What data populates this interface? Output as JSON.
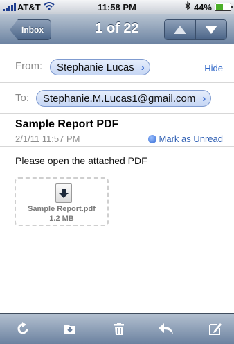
{
  "status_bar": {
    "carrier": "AT&T",
    "time": "11:58 PM",
    "battery_percent": "44%",
    "battery_level": 0.44,
    "icons": [
      "signal-icon",
      "wifi-icon",
      "bluetooth-icon",
      "battery-icon"
    ]
  },
  "nav": {
    "back_label": "Inbox",
    "title": "1 of 22",
    "prev_icon": "up-arrow-icon",
    "next_icon": "down-arrow-icon"
  },
  "header": {
    "from_label": "From:",
    "from_name": "Stephanie Lucas",
    "hide_label": "Hide",
    "to_label": "To:",
    "to_address": "Stephanie.M.Lucas1@gmail.com"
  },
  "message": {
    "subject": "Sample Report PDF",
    "date": "2/1/11 11:57 PM",
    "mark_unread_label": "Mark as Unread",
    "body": "Please open the attached PDF"
  },
  "attachment": {
    "file_name": "Sample Report.pdf",
    "file_size": "1.2 MB"
  },
  "toolbar": {
    "icons": [
      "refresh-icon",
      "move-to-folder-icon",
      "trash-icon",
      "reply-icon",
      "compose-icon"
    ]
  },
  "colors": {
    "nav_bar": "#6d84a2",
    "link": "#2f67c8",
    "chip_border": "#7f9bd0"
  }
}
